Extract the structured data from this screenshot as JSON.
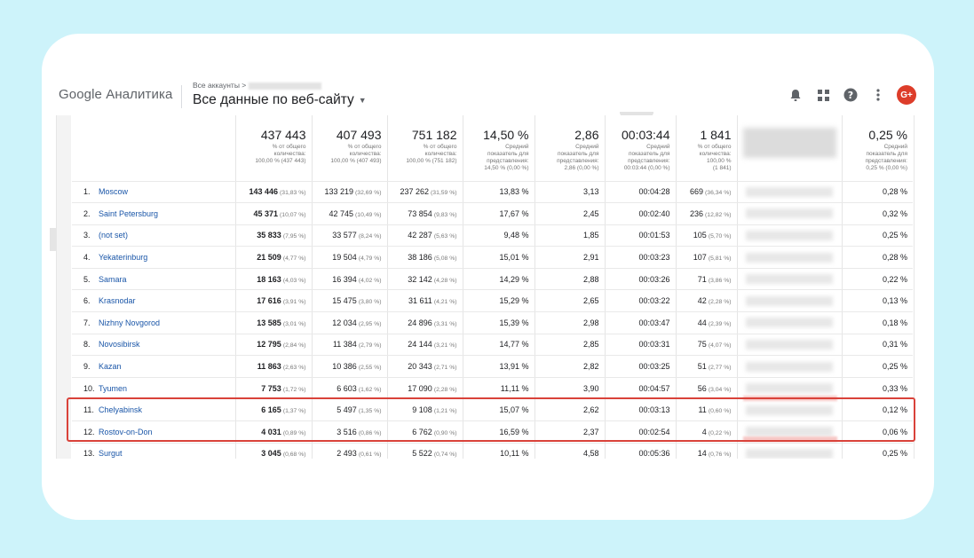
{
  "header": {
    "product": "Google Аналитика",
    "breadcrumb": "Все аккаунты >",
    "property": "Все данные по веб-сайту",
    "avatar": "G+"
  },
  "colors": {
    "accent_link": "#1a56a8",
    "highlight": "#d9423a",
    "avatar": "#dd3d2a"
  },
  "summary": [
    {
      "main": "437 443",
      "l1": "% от общего",
      "l2": "количества:",
      "l3": "100,00 % (437 443)"
    },
    {
      "main": "407 493",
      "l1": "% от общего",
      "l2": "количества:",
      "l3": "100,00 % (407 493)"
    },
    {
      "main": "751 182",
      "l1": "% от общего",
      "l2": "количества:",
      "l3": "100,00 % (751 182)"
    },
    {
      "main": "14,50 %",
      "l1": "Средний",
      "l2": "показатель для",
      "l3": "представления:",
      "l4": "14,50 % (0,00 %)"
    },
    {
      "main": "2,86",
      "l1": "Средний",
      "l2": "показатель для",
      "l3": "представления:",
      "l4": "2,86 (0,00 %)"
    },
    {
      "main": "00:03:44",
      "l1": "Средний",
      "l2": "показатель для",
      "l3": "представления:",
      "l4": "00:03:44 (0,00 %)"
    },
    {
      "main": "1 841",
      "l1": "% от общего",
      "l2": "количества:",
      "l3": "100,00 %",
      "l4": "(1 841)"
    },
    {
      "main": "0,25 %",
      "l1": "Средний",
      "l2": "показатель для",
      "l3": "представления:",
      "l4": "0,25 % (0,00 %)"
    }
  ],
  "rows": [
    {
      "n": "1.",
      "city": "Moscow",
      "c1": "143 446",
      "p1": "(31,83 %)",
      "c2": "133 219",
      "p2": "(32,69 %)",
      "c3": "237 262",
      "p3": "(31,59 %)",
      "c4": "13,83 %",
      "c5": "3,13",
      "c6": "00:04:28",
      "c7": "669",
      "p7": "(36,34 %)",
      "c9": "0,28 %"
    },
    {
      "n": "2.",
      "city": "Saint Petersburg",
      "c1": "45 371",
      "p1": "(10,07 %)",
      "c2": "42 745",
      "p2": "(10,49 %)",
      "c3": "73 854",
      "p3": "(9,83 %)",
      "c4": "17,67 %",
      "c5": "2,45",
      "c6": "00:02:40",
      "c7": "236",
      "p7": "(12,82 %)",
      "c9": "0,32 %"
    },
    {
      "n": "3.",
      "city": "(not set)",
      "c1": "35 833",
      "p1": "(7,95 %)",
      "c2": "33 577",
      "p2": "(8,24 %)",
      "c3": "42 287",
      "p3": "(5,63 %)",
      "c4": "9,48 %",
      "c5": "1,85",
      "c6": "00:01:53",
      "c7": "105",
      "p7": "(5,70 %)",
      "c9": "0,25 %"
    },
    {
      "n": "4.",
      "city": "Yekaterinburg",
      "c1": "21 509",
      "p1": "(4,77 %)",
      "c2": "19 504",
      "p2": "(4,79 %)",
      "c3": "38 186",
      "p3": "(5,08 %)",
      "c4": "15,01 %",
      "c5": "2,91",
      "c6": "00:03:23",
      "c7": "107",
      "p7": "(5,81 %)",
      "c9": "0,28 %"
    },
    {
      "n": "5.",
      "city": "Samara",
      "c1": "18 163",
      "p1": "(4,03 %)",
      "c2": "16 394",
      "p2": "(4,02 %)",
      "c3": "32 142",
      "p3": "(4,28 %)",
      "c4": "14,29 %",
      "c5": "2,88",
      "c6": "00:03:26",
      "c7": "71",
      "p7": "(3,86 %)",
      "c9": "0,22 %"
    },
    {
      "n": "6.",
      "city": "Krasnodar",
      "c1": "17 616",
      "p1": "(3,91 %)",
      "c2": "15 475",
      "p2": "(3,80 %)",
      "c3": "31 611",
      "p3": "(4,21 %)",
      "c4": "15,29 %",
      "c5": "2,65",
      "c6": "00:03:22",
      "c7": "42",
      "p7": "(2,28 %)",
      "c9": "0,13 %"
    },
    {
      "n": "7.",
      "city": "Nizhny Novgorod",
      "c1": "13 585",
      "p1": "(3,01 %)",
      "c2": "12 034",
      "p2": "(2,95 %)",
      "c3": "24 896",
      "p3": "(3,31 %)",
      "c4": "15,39 %",
      "c5": "2,98",
      "c6": "00:03:47",
      "c7": "44",
      "p7": "(2,39 %)",
      "c9": "0,18 %"
    },
    {
      "n": "8.",
      "city": "Novosibirsk",
      "c1": "12 795",
      "p1": "(2,84 %)",
      "c2": "11 384",
      "p2": "(2,79 %)",
      "c3": "24 144",
      "p3": "(3,21 %)",
      "c4": "14,77 %",
      "c5": "2,85",
      "c6": "00:03:31",
      "c7": "75",
      "p7": "(4,07 %)",
      "c9": "0,31 %"
    },
    {
      "n": "9.",
      "city": "Kazan",
      "c1": "11 863",
      "p1": "(2,63 %)",
      "c2": "10 386",
      "p2": "(2,55 %)",
      "c3": "20 343",
      "p3": "(2,71 %)",
      "c4": "13,91 %",
      "c5": "2,82",
      "c6": "00:03:25",
      "c7": "51",
      "p7": "(2,77 %)",
      "c9": "0,25 %"
    },
    {
      "n": "10.",
      "city": "Tyumen",
      "c1": "7 753",
      "p1": "(1,72 %)",
      "c2": "6 603",
      "p2": "(1,62 %)",
      "c3": "17 090",
      "p3": "(2,28 %)",
      "c4": "11,11 %",
      "c5": "3,90",
      "c6": "00:04:57",
      "c7": "56",
      "p7": "(3,04 %)",
      "c9": "0,33 %"
    },
    {
      "n": "11.",
      "city": "Chelyabinsk",
      "c1": "6 165",
      "p1": "(1,37 %)",
      "c2": "5 497",
      "p2": "(1,35 %)",
      "c3": "9 108",
      "p3": "(1,21 %)",
      "c4": "15,07 %",
      "c5": "2,62",
      "c6": "00:03:13",
      "c7": "11",
      "p7": "(0,60 %)",
      "c9": "0,12 %"
    },
    {
      "n": "12.",
      "city": "Rostov-on-Don",
      "c1": "4 031",
      "p1": "(0,89 %)",
      "c2": "3 516",
      "p2": "(0,86 %)",
      "c3": "6 762",
      "p3": "(0,90 %)",
      "c4": "16,59 %",
      "c5": "2,37",
      "c6": "00:02:54",
      "c7": "4",
      "p7": "(0,22 %)",
      "c9": "0,06 %"
    },
    {
      "n": "13.",
      "city": "Surgut",
      "c1": "3 045",
      "p1": "(0,68 %)",
      "c2": "2 493",
      "p2": "(0,61 %)",
      "c3": "5 522",
      "p3": "(0,74 %)",
      "c4": "10,11 %",
      "c5": "4,58",
      "c6": "00:05:36",
      "c7": "14",
      "p7": "(0,76 %)",
      "c9": "0,25 %"
    }
  ]
}
